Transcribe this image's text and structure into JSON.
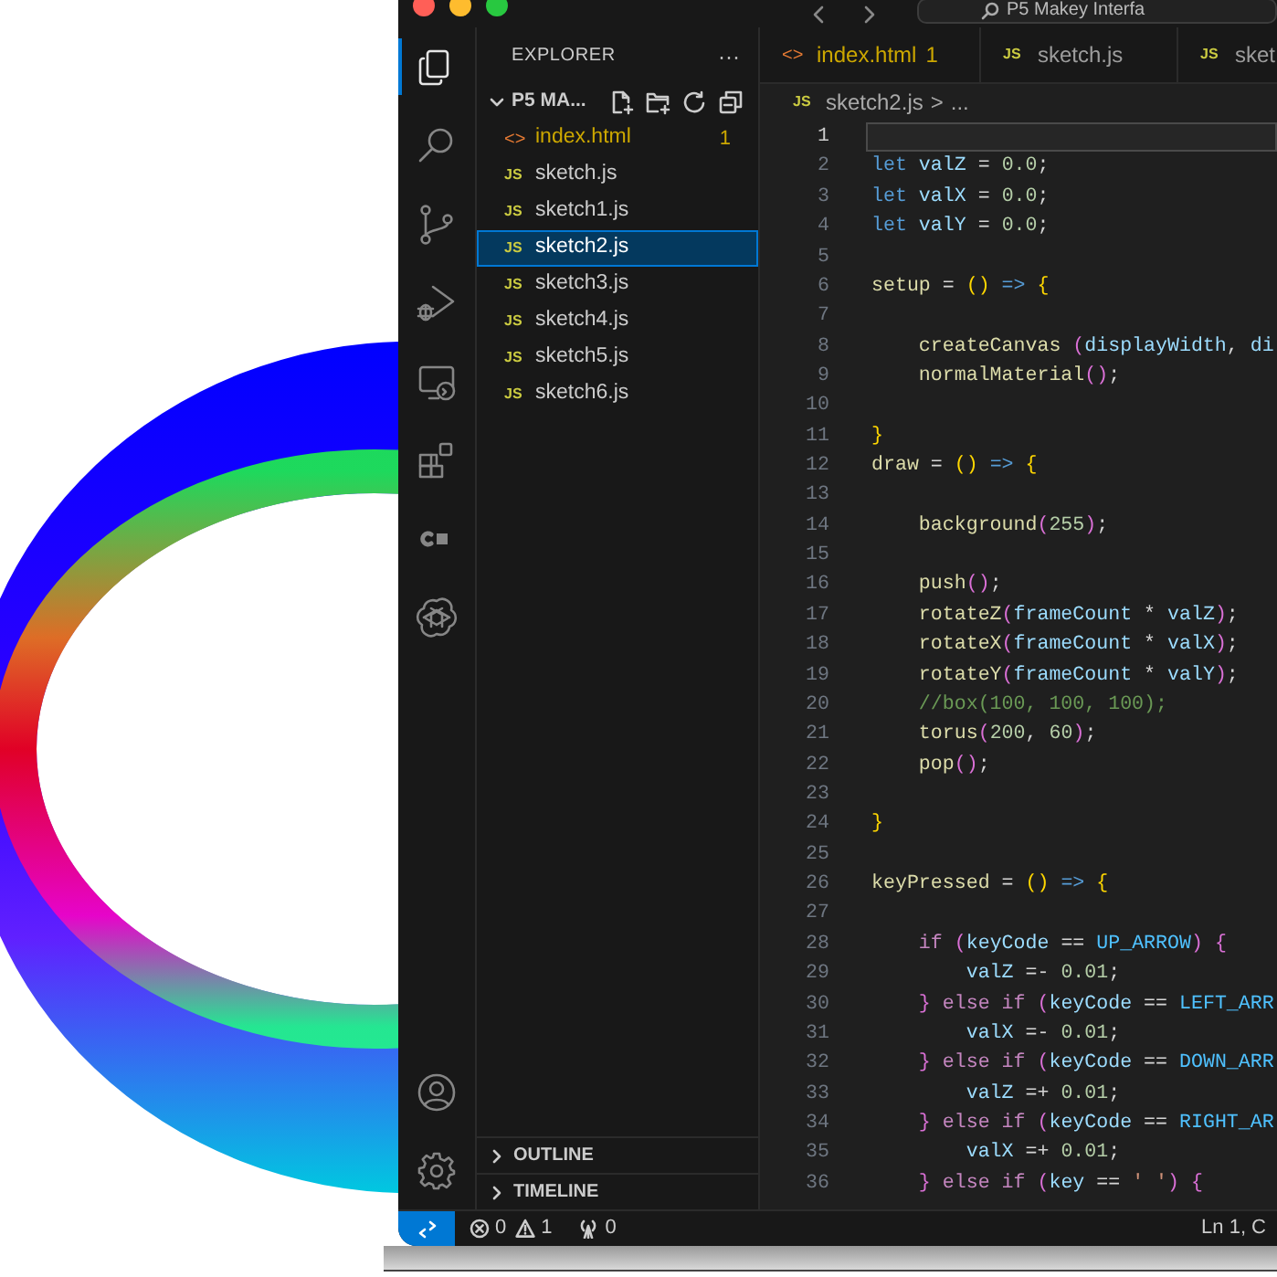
{
  "title_bar": {
    "command_center": "P5 Makey Interfa"
  },
  "activity_bar": [
    {
      "kind": "explorer",
      "selected": true
    },
    {
      "kind": "search",
      "selected": false
    },
    {
      "kind": "source-control",
      "selected": false
    },
    {
      "kind": "run-debug",
      "selected": false
    },
    {
      "kind": "remote",
      "selected": false
    },
    {
      "kind": "extensions",
      "selected": false
    },
    {
      "kind": "c-block",
      "selected": false
    },
    {
      "kind": "knot",
      "selected": false
    }
  ],
  "activity_bar_bottom": [
    {
      "kind": "account"
    },
    {
      "kind": "settings"
    }
  ],
  "sidebar": {
    "title": "EXPLORER",
    "more": "···",
    "folder": {
      "name": "P5 MA...",
      "expanded": true,
      "files": [
        {
          "icon": "<>",
          "kind": "html",
          "name": "index.html",
          "badge": "1",
          "warning": true,
          "selected": false
        },
        {
          "icon": "JS",
          "kind": "js",
          "name": "sketch.js",
          "warning": false,
          "selected": false
        },
        {
          "icon": "JS",
          "kind": "js",
          "name": "sketch1.js",
          "warning": false,
          "selected": false
        },
        {
          "icon": "JS",
          "kind": "js",
          "name": "sketch2.js",
          "warning": false,
          "selected": true
        },
        {
          "icon": "JS",
          "kind": "js",
          "name": "sketch3.js",
          "warning": false,
          "selected": false
        },
        {
          "icon": "JS",
          "kind": "js",
          "name": "sketch4.js",
          "warning": false,
          "selected": false
        },
        {
          "icon": "JS",
          "kind": "js",
          "name": "sketch5.js",
          "warning": false,
          "selected": false
        },
        {
          "icon": "JS",
          "kind": "js",
          "name": "sketch6.js",
          "warning": false,
          "selected": false
        }
      ]
    },
    "sections": [
      {
        "label": "OUTLINE",
        "expanded": false
      },
      {
        "label": "TIMELINE",
        "expanded": false
      }
    ]
  },
  "tabs": [
    {
      "icon": "<>",
      "kind": "html",
      "name": "index.html",
      "badge": "1",
      "warning": true,
      "selected": false
    },
    {
      "icon": "JS",
      "kind": "js",
      "name": "sketch.js",
      "warning": false,
      "selected": false
    },
    {
      "icon": "JS",
      "kind": "js",
      "name": "sket",
      "warning": false,
      "selected": false
    }
  ],
  "breadcrumb": {
    "icon": "JS",
    "file": "sketch2.js",
    "separator": ">",
    "rest": "..."
  },
  "editor": {
    "lines": [
      {
        "number": "1",
        "current": true
      },
      {
        "number": "2",
        "current": false,
        "tokens": [
          {
            "kind": "kw",
            "text": "let"
          },
          {
            "kind": "v",
            "text": " valZ"
          },
          {
            "kind": "p",
            "text": " = "
          },
          {
            "kind": "n",
            "text": "0.0"
          },
          {
            "kind": "p",
            "text": ";"
          }
        ]
      },
      {
        "number": "3",
        "current": false,
        "tokens": [
          {
            "kind": "kw",
            "text": "let"
          },
          {
            "kind": "v",
            "text": " valX"
          },
          {
            "kind": "p",
            "text": " = "
          },
          {
            "kind": "n",
            "text": "0.0"
          },
          {
            "kind": "p",
            "text": ";"
          }
        ]
      },
      {
        "number": "4",
        "current": false,
        "tokens": [
          {
            "kind": "kw",
            "text": "let"
          },
          {
            "kind": "v",
            "text": " valY"
          },
          {
            "kind": "p",
            "text": " = "
          },
          {
            "kind": "n",
            "text": "0.0"
          },
          {
            "kind": "p",
            "text": ";"
          }
        ]
      },
      {
        "number": "5",
        "current": false
      },
      {
        "number": "6",
        "current": false,
        "tokens": [
          {
            "kind": "f",
            "text": "setup"
          },
          {
            "kind": "p",
            "text": " = "
          },
          {
            "kind": "b1",
            "text": "()"
          },
          {
            "kind": "kw",
            "text": " =>"
          },
          {
            "kind": "b1",
            "text": " {"
          }
        ]
      },
      {
        "number": "7",
        "current": false
      },
      {
        "number": "8",
        "current": false,
        "tokens": [
          {
            "kind": "f",
            "text": "    createCanvas"
          },
          {
            "kind": "b2",
            "text": " ("
          },
          {
            "kind": "v",
            "text": "displayWidth"
          },
          {
            "kind": "p",
            "text": ", "
          },
          {
            "kind": "v",
            "text": "di"
          }
        ]
      },
      {
        "number": "9",
        "current": false,
        "tokens": [
          {
            "kind": "f",
            "text": "    normalMaterial"
          },
          {
            "kind": "b2",
            "text": "()"
          },
          {
            "kind": "p",
            "text": ";"
          }
        ]
      },
      {
        "number": "10",
        "current": false
      },
      {
        "number": "11",
        "current": false,
        "tokens": [
          {
            "kind": "b1",
            "text": "}"
          }
        ]
      },
      {
        "number": "12",
        "current": false,
        "tokens": [
          {
            "kind": "f",
            "text": "draw"
          },
          {
            "kind": "p",
            "text": " = "
          },
          {
            "kind": "b1",
            "text": "()"
          },
          {
            "kind": "kw",
            "text": " =>"
          },
          {
            "kind": "b1",
            "text": " {"
          }
        ]
      },
      {
        "number": "13",
        "current": false
      },
      {
        "number": "14",
        "current": false,
        "tokens": [
          {
            "kind": "f",
            "text": "    background"
          },
          {
            "kind": "b2",
            "text": "("
          },
          {
            "kind": "n",
            "text": "255"
          },
          {
            "kind": "b2",
            "text": ")"
          },
          {
            "kind": "p",
            "text": ";"
          }
        ]
      },
      {
        "number": "15",
        "current": false
      },
      {
        "number": "16",
        "current": false,
        "tokens": [
          {
            "kind": "f",
            "text": "    push"
          },
          {
            "kind": "b2",
            "text": "()"
          },
          {
            "kind": "p",
            "text": ";"
          }
        ]
      },
      {
        "number": "17",
        "current": false,
        "tokens": [
          {
            "kind": "f",
            "text": "    rotateZ"
          },
          {
            "kind": "b2",
            "text": "("
          },
          {
            "kind": "v",
            "text": "frameCount"
          },
          {
            "kind": "p",
            "text": " * "
          },
          {
            "kind": "v",
            "text": "valZ"
          },
          {
            "kind": "b2",
            "text": ")"
          },
          {
            "kind": "p",
            "text": ";"
          }
        ]
      },
      {
        "number": "18",
        "current": false,
        "tokens": [
          {
            "kind": "f",
            "text": "    rotateX"
          },
          {
            "kind": "b2",
            "text": "("
          },
          {
            "kind": "v",
            "text": "frameCount"
          },
          {
            "kind": "p",
            "text": " * "
          },
          {
            "kind": "v",
            "text": "valX"
          },
          {
            "kind": "b2",
            "text": ")"
          },
          {
            "kind": "p",
            "text": ";"
          }
        ]
      },
      {
        "number": "19",
        "current": false,
        "tokens": [
          {
            "kind": "f",
            "text": "    rotateY"
          },
          {
            "kind": "b2",
            "text": "("
          },
          {
            "kind": "v",
            "text": "frameCount"
          },
          {
            "kind": "p",
            "text": " * "
          },
          {
            "kind": "v",
            "text": "valY"
          },
          {
            "kind": "b2",
            "text": ")"
          },
          {
            "kind": "p",
            "text": ";"
          }
        ]
      },
      {
        "number": "20",
        "current": false,
        "tokens": [
          {
            "kind": "c",
            "text": "    //box(100, 100, 100);"
          }
        ]
      },
      {
        "number": "21",
        "current": false,
        "tokens": [
          {
            "kind": "f",
            "text": "    torus"
          },
          {
            "kind": "b2",
            "text": "("
          },
          {
            "kind": "n",
            "text": "200"
          },
          {
            "kind": "p",
            "text": ", "
          },
          {
            "kind": "n",
            "text": "60"
          },
          {
            "kind": "b2",
            "text": ")"
          },
          {
            "kind": "p",
            "text": ";"
          }
        ]
      },
      {
        "number": "22",
        "current": false,
        "tokens": [
          {
            "kind": "f",
            "text": "    pop"
          },
          {
            "kind": "b2",
            "text": "()"
          },
          {
            "kind": "p",
            "text": ";"
          }
        ]
      },
      {
        "number": "23",
        "current": false
      },
      {
        "number": "24",
        "current": false,
        "tokens": [
          {
            "kind": "b1",
            "text": "}"
          }
        ]
      },
      {
        "number": "25",
        "current": false
      },
      {
        "number": "26",
        "current": false,
        "tokens": [
          {
            "kind": "f",
            "text": "keyPressed"
          },
          {
            "kind": "p",
            "text": " = "
          },
          {
            "kind": "b1",
            "text": "()"
          },
          {
            "kind": "kw",
            "text": " =>"
          },
          {
            "kind": "b1",
            "text": " {"
          }
        ]
      },
      {
        "number": "27",
        "current": false
      },
      {
        "number": "28",
        "current": false,
        "tokens": [
          {
            "kind": "k",
            "text": "    if"
          },
          {
            "kind": "b2",
            "text": " ("
          },
          {
            "kind": "v",
            "text": "keyCode"
          },
          {
            "kind": "p",
            "text": " == "
          },
          {
            "kind": "cst",
            "text": "UP_ARROW"
          },
          {
            "kind": "b2",
            "text": ")"
          },
          {
            "kind": "b2",
            "text": " {"
          }
        ]
      },
      {
        "number": "29",
        "current": false,
        "tokens": [
          {
            "kind": "v",
            "text": "        valZ"
          },
          {
            "kind": "p",
            "text": " =- "
          },
          {
            "kind": "n",
            "text": "0.01"
          },
          {
            "kind": "p",
            "text": ";"
          }
        ]
      },
      {
        "number": "30",
        "current": false,
        "tokens": [
          {
            "kind": "b2",
            "text": "    }"
          },
          {
            "kind": "k",
            "text": " else if"
          },
          {
            "kind": "b2",
            "text": " ("
          },
          {
            "kind": "v",
            "text": "keyCode"
          },
          {
            "kind": "p",
            "text": " == "
          },
          {
            "kind": "cst",
            "text": "LEFT_ARR"
          }
        ]
      },
      {
        "number": "31",
        "current": false,
        "tokens": [
          {
            "kind": "v",
            "text": "        valX"
          },
          {
            "kind": "p",
            "text": " =- "
          },
          {
            "kind": "n",
            "text": "0.01"
          },
          {
            "kind": "p",
            "text": ";"
          }
        ]
      },
      {
        "number": "32",
        "current": false,
        "tokens": [
          {
            "kind": "b2",
            "text": "    }"
          },
          {
            "kind": "k",
            "text": " else if"
          },
          {
            "kind": "b2",
            "text": " ("
          },
          {
            "kind": "v",
            "text": "keyCode"
          },
          {
            "kind": "p",
            "text": " == "
          },
          {
            "kind": "cst",
            "text": "DOWN_ARR"
          }
        ]
      },
      {
        "number": "33",
        "current": false,
        "tokens": [
          {
            "kind": "v",
            "text": "        valZ"
          },
          {
            "kind": "p",
            "text": " =+ "
          },
          {
            "kind": "n",
            "text": "0.01"
          },
          {
            "kind": "p",
            "text": ";"
          }
        ]
      },
      {
        "number": "34",
        "current": false,
        "tokens": [
          {
            "kind": "b2",
            "text": "    }"
          },
          {
            "kind": "k",
            "text": " else if"
          },
          {
            "kind": "b2",
            "text": " ("
          },
          {
            "kind": "v",
            "text": "keyCode"
          },
          {
            "kind": "p",
            "text": " == "
          },
          {
            "kind": "cst",
            "text": "RIGHT_AR"
          }
        ]
      },
      {
        "number": "35",
        "current": false,
        "tokens": [
          {
            "kind": "v",
            "text": "        valX"
          },
          {
            "kind": "p",
            "text": " =+ "
          },
          {
            "kind": "n",
            "text": "0.01"
          },
          {
            "kind": "p",
            "text": ";"
          }
        ]
      },
      {
        "number": "36",
        "current": false,
        "tokens": [
          {
            "kind": "b2",
            "text": "    }"
          },
          {
            "kind": "k",
            "text": " else if"
          },
          {
            "kind": "b2",
            "text": " ("
          },
          {
            "kind": "v",
            "text": "key"
          },
          {
            "kind": "p",
            "text": " == "
          },
          {
            "kind": "s",
            "text": "' '"
          },
          {
            "kind": "b2",
            "text": ")"
          },
          {
            "kind": "b2",
            "text": " {"
          }
        ]
      }
    ]
  },
  "status_bar": {
    "errors": "0",
    "warnings": "1",
    "ports": "0",
    "position": "Ln 1, C"
  }
}
